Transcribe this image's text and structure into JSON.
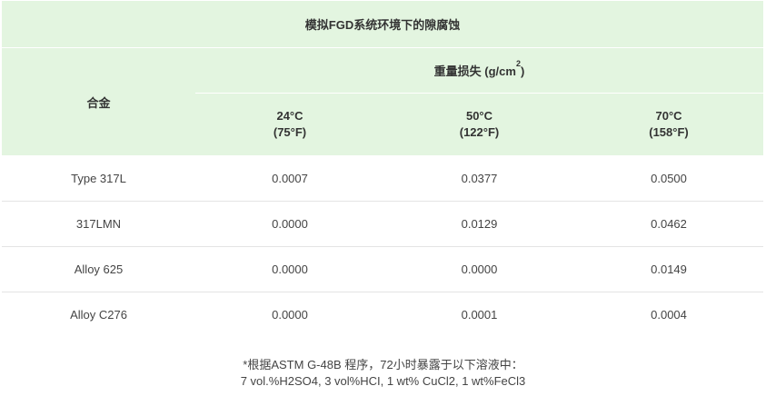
{
  "table": {
    "title": "模拟FGD系统环境下的隙腐蚀",
    "alloy_header": "合金",
    "weight_loss_header": {
      "text": "重量损失 (g/cm",
      "sup": "2",
      "close": ")"
    },
    "temperatures": [
      {
        "c": "24°C",
        "f": "(75°F)"
      },
      {
        "c": "50°C",
        "f": "(122°F)"
      },
      {
        "c": "70°C",
        "f": "(158°F)"
      }
    ],
    "rows": [
      {
        "alloy": "Type 317L",
        "values": [
          "0.0007",
          "0.0377",
          "0.0500"
        ]
      },
      {
        "alloy": "317LMN",
        "values": [
          "0.0000",
          "0.0129",
          "0.0462"
        ]
      },
      {
        "alloy": "Alloy 625",
        "values": [
          "0.0000",
          "0.0000",
          "0.0149"
        ]
      },
      {
        "alloy": "Alloy C276",
        "values": [
          "0.0000",
          "0.0001",
          "0.0004"
        ]
      }
    ]
  },
  "footnote": {
    "line1": "*根据ASTM G-48B 程序，72小时暴露于以下溶液中：",
    "line2": "7 vol.%H2SO4, 3 vol%HCI, 1 wt% CuCl2, 1 wt%FeCl3"
  },
  "colors": {
    "header_bg": "#e3f5e0",
    "text": "#333333",
    "cell_text": "#444444",
    "border": "#e4e4e4"
  }
}
